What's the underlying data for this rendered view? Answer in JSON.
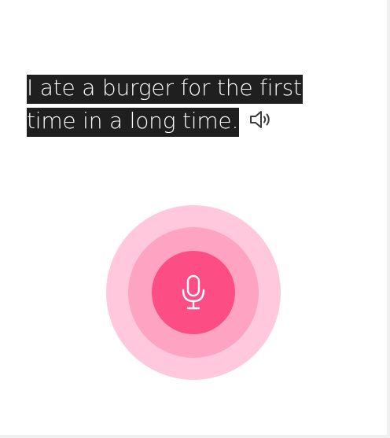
{
  "prompt": {
    "text": "I ate a burger for the first time in a long time."
  },
  "icons": {
    "speaker": "speaker-icon",
    "microphone": "microphone-icon"
  },
  "colors": {
    "highlight_bg": "#1f1f1f",
    "highlight_text": "#ffffff",
    "ring_outer": "#ffc8dc",
    "ring_mid": "#ffa3c2",
    "ring_inner": "#fd4d85",
    "speaker_stroke": "#3a3a3a"
  }
}
